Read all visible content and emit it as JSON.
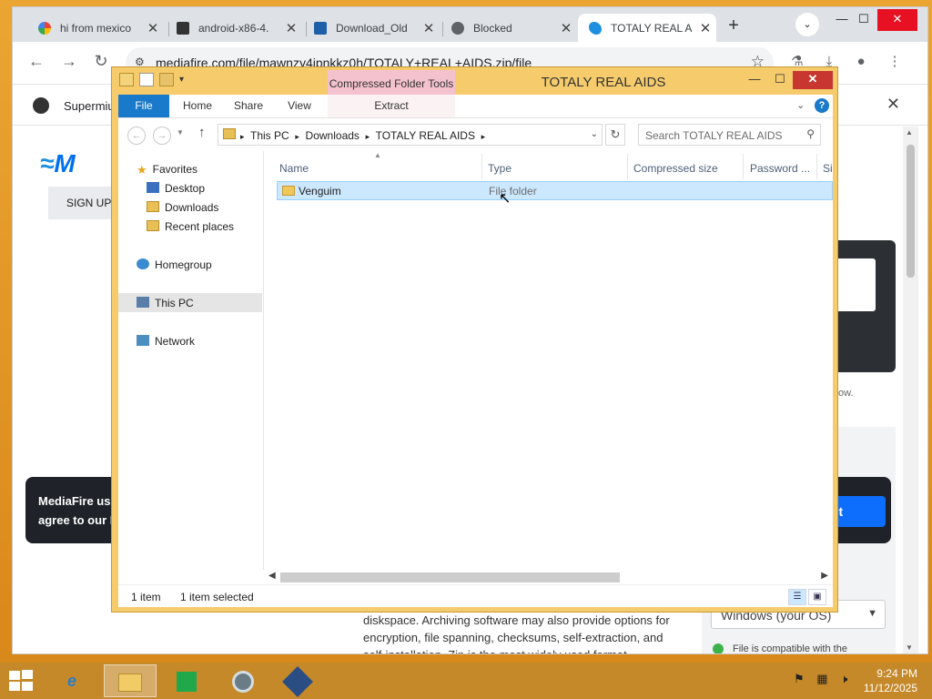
{
  "browser": {
    "tabs": [
      {
        "title": "hi from mexico",
        "favicon": "google-g-icon"
      },
      {
        "title": "android-x86-4.",
        "favicon": "archive-icon"
      },
      {
        "title": "Download_Old",
        "favicon": "vertex-icon"
      },
      {
        "title": "Blocked",
        "favicon": "blocked-icon"
      },
      {
        "title": "TOTALY REAL A",
        "favicon": "mediafire-icon"
      }
    ],
    "active_tab_index": 4,
    "url": "mediafire.com/file/mawnzy4jpnkkz0h/TOTALY+REAL+AIDS.zip/file",
    "infobar_text": "Supermiu"
  },
  "page": {
    "logo_text": "M",
    "signup_label": "SIGN UP",
    "how_text": "ow.",
    "cookie_line1": "MediaFire use",
    "cookie_line2": "agree to our F",
    "accept_label": "pt",
    "article_text": "diskspace. Archiving software may also provide options for encryption, file spanning, checksums, self-extraction, and self-installation. Zip is the most widely used format",
    "os_select": "Windows (your OS)",
    "compat_text": "File is compatible with the"
  },
  "explorer": {
    "context_tab": "Compressed Folder Tools",
    "title": "TOTALY REAL AIDS",
    "ribbon_tabs": [
      "File",
      "Home",
      "Share",
      "View",
      "Extract"
    ],
    "breadcrumbs": [
      "This PC",
      "Downloads",
      "TOTALY REAL AIDS"
    ],
    "search_placeholder": "Search TOTALY REAL AIDS",
    "nav": {
      "favorites": "Favorites",
      "desktop": "Desktop",
      "downloads": "Downloads",
      "recent": "Recent places",
      "homegroup": "Homegroup",
      "thispc": "This PC",
      "network": "Network"
    },
    "columns": [
      "Name",
      "Type",
      "Compressed size",
      "Password ...",
      "Si"
    ],
    "rows": [
      {
        "name": "Venguim",
        "type": "File folder"
      }
    ],
    "status_count": "1 item",
    "status_selected": "1 item selected"
  },
  "taskbar": {
    "time": "9:24 PM",
    "date": "11/12/2025"
  },
  "colors": {
    "desktop": "#e69a1e",
    "explorer_frame": "#f5cb6c",
    "file_tab": "#1979ca",
    "selection": "#cce8ff",
    "close_red": "#c7372f"
  }
}
